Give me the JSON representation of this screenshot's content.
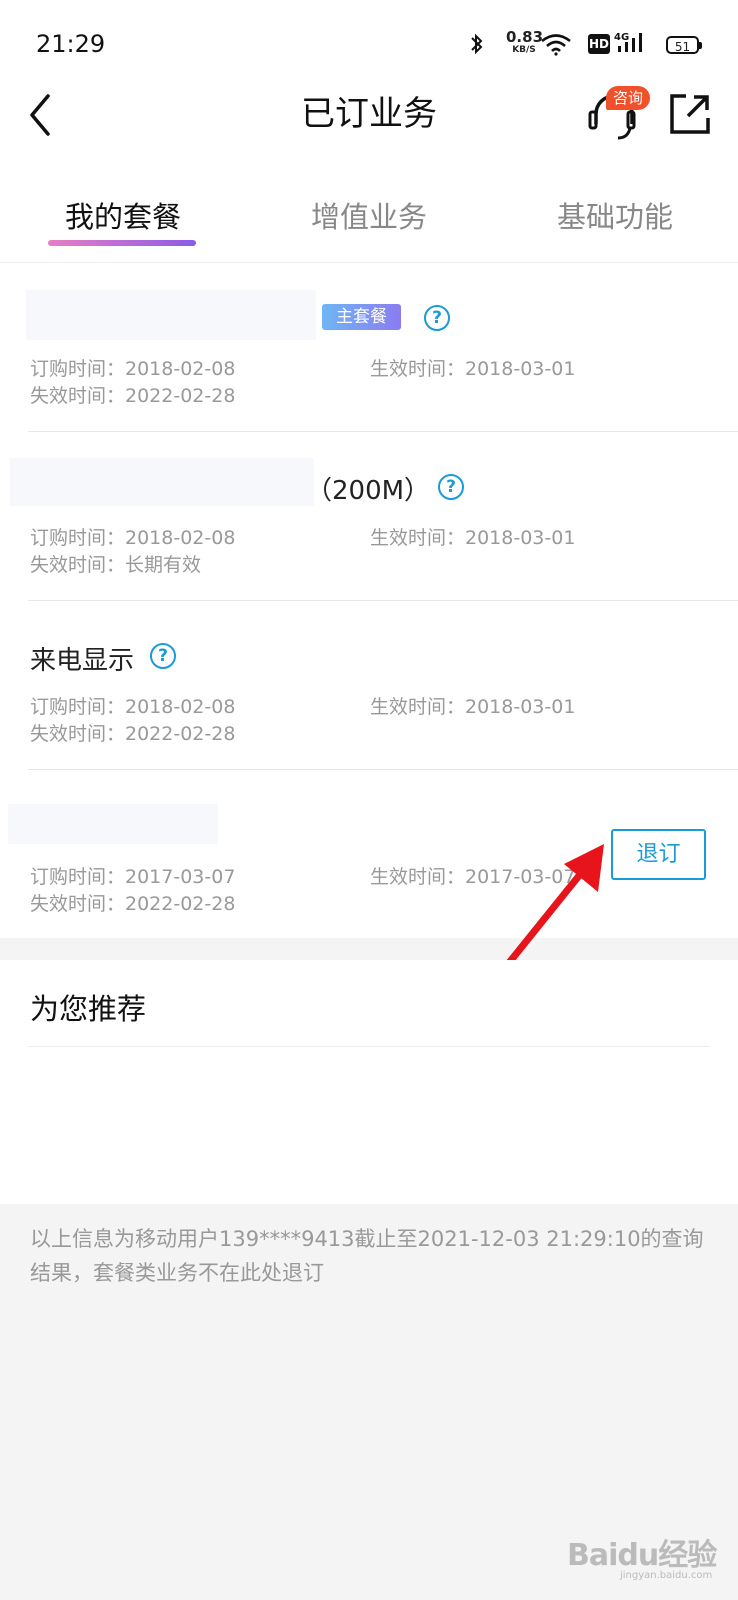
{
  "status_bar": {
    "time": "21:29",
    "net_speed": "0.83",
    "net_speed_unit": "KB/S",
    "hd": "HD",
    "signal_label": "4G",
    "battery": "51"
  },
  "nav": {
    "title": "已订业务",
    "consult_badge": "咨询",
    "back_icon": "chevron-left-icon",
    "consult_icon": "headset-icon",
    "share_icon": "share-icon"
  },
  "tabs": [
    {
      "label": "我的套餐",
      "active": true
    },
    {
      "label": "增值业务",
      "active": false
    },
    {
      "label": "基础功能",
      "active": false
    }
  ],
  "items": [
    {
      "name": "",
      "tag": "主套餐",
      "order_time": "订购时间：2018-02-08",
      "effective_time": "生效时间：2018-03-01",
      "expire_time": "失效时间：2022-02-28"
    },
    {
      "name": "（200M）",
      "order_time": "订购时间：2018-02-08",
      "effective_time": "生效时间：2018-03-01",
      "expire_time": "失效时间：长期有效"
    },
    {
      "name": "来电显示",
      "order_time": "订购时间：2018-02-08",
      "effective_time": "生效时间：2018-03-01",
      "expire_time": "失效时间：2022-02-28"
    },
    {
      "name": "",
      "order_time": "订购时间：2017-03-07",
      "effective_time": "生效时间：2017-03-07",
      "expire_time": "失效时间：2022-02-28",
      "action": "退订"
    }
  ],
  "recommend": {
    "title": "为您推荐"
  },
  "footer_note": "以上信息为移动用户139****9413截止至2021-12-03 21:29:10的查询结果，套餐类业务不在此处退订",
  "watermark": {
    "text": "Baidu经验",
    "url": "jingyan.baidu.com"
  },
  "colors": {
    "accent_blue": "#1a9bd8",
    "badge_orange": "#f0512b",
    "arrow_red": "#e8141b"
  }
}
